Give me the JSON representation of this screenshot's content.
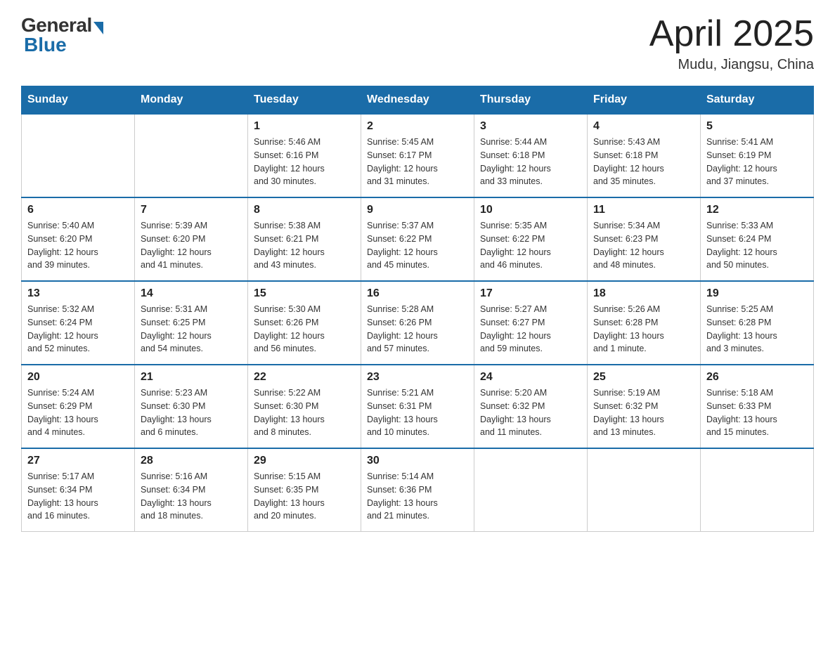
{
  "header": {
    "logo": {
      "general": "General",
      "blue": "Blue"
    },
    "title": "April 2025",
    "location": "Mudu, Jiangsu, China"
  },
  "calendar": {
    "days_of_week": [
      "Sunday",
      "Monday",
      "Tuesday",
      "Wednesday",
      "Thursday",
      "Friday",
      "Saturday"
    ],
    "weeks": [
      [
        {
          "day": "",
          "info": ""
        },
        {
          "day": "",
          "info": ""
        },
        {
          "day": "1",
          "info": "Sunrise: 5:46 AM\nSunset: 6:16 PM\nDaylight: 12 hours\nand 30 minutes."
        },
        {
          "day": "2",
          "info": "Sunrise: 5:45 AM\nSunset: 6:17 PM\nDaylight: 12 hours\nand 31 minutes."
        },
        {
          "day": "3",
          "info": "Sunrise: 5:44 AM\nSunset: 6:18 PM\nDaylight: 12 hours\nand 33 minutes."
        },
        {
          "day": "4",
          "info": "Sunrise: 5:43 AM\nSunset: 6:18 PM\nDaylight: 12 hours\nand 35 minutes."
        },
        {
          "day": "5",
          "info": "Sunrise: 5:41 AM\nSunset: 6:19 PM\nDaylight: 12 hours\nand 37 minutes."
        }
      ],
      [
        {
          "day": "6",
          "info": "Sunrise: 5:40 AM\nSunset: 6:20 PM\nDaylight: 12 hours\nand 39 minutes."
        },
        {
          "day": "7",
          "info": "Sunrise: 5:39 AM\nSunset: 6:20 PM\nDaylight: 12 hours\nand 41 minutes."
        },
        {
          "day": "8",
          "info": "Sunrise: 5:38 AM\nSunset: 6:21 PM\nDaylight: 12 hours\nand 43 minutes."
        },
        {
          "day": "9",
          "info": "Sunrise: 5:37 AM\nSunset: 6:22 PM\nDaylight: 12 hours\nand 45 minutes."
        },
        {
          "day": "10",
          "info": "Sunrise: 5:35 AM\nSunset: 6:22 PM\nDaylight: 12 hours\nand 46 minutes."
        },
        {
          "day": "11",
          "info": "Sunrise: 5:34 AM\nSunset: 6:23 PM\nDaylight: 12 hours\nand 48 minutes."
        },
        {
          "day": "12",
          "info": "Sunrise: 5:33 AM\nSunset: 6:24 PM\nDaylight: 12 hours\nand 50 minutes."
        }
      ],
      [
        {
          "day": "13",
          "info": "Sunrise: 5:32 AM\nSunset: 6:24 PM\nDaylight: 12 hours\nand 52 minutes."
        },
        {
          "day": "14",
          "info": "Sunrise: 5:31 AM\nSunset: 6:25 PM\nDaylight: 12 hours\nand 54 minutes."
        },
        {
          "day": "15",
          "info": "Sunrise: 5:30 AM\nSunset: 6:26 PM\nDaylight: 12 hours\nand 56 minutes."
        },
        {
          "day": "16",
          "info": "Sunrise: 5:28 AM\nSunset: 6:26 PM\nDaylight: 12 hours\nand 57 minutes."
        },
        {
          "day": "17",
          "info": "Sunrise: 5:27 AM\nSunset: 6:27 PM\nDaylight: 12 hours\nand 59 minutes."
        },
        {
          "day": "18",
          "info": "Sunrise: 5:26 AM\nSunset: 6:28 PM\nDaylight: 13 hours\nand 1 minute."
        },
        {
          "day": "19",
          "info": "Sunrise: 5:25 AM\nSunset: 6:28 PM\nDaylight: 13 hours\nand 3 minutes."
        }
      ],
      [
        {
          "day": "20",
          "info": "Sunrise: 5:24 AM\nSunset: 6:29 PM\nDaylight: 13 hours\nand 4 minutes."
        },
        {
          "day": "21",
          "info": "Sunrise: 5:23 AM\nSunset: 6:30 PM\nDaylight: 13 hours\nand 6 minutes."
        },
        {
          "day": "22",
          "info": "Sunrise: 5:22 AM\nSunset: 6:30 PM\nDaylight: 13 hours\nand 8 minutes."
        },
        {
          "day": "23",
          "info": "Sunrise: 5:21 AM\nSunset: 6:31 PM\nDaylight: 13 hours\nand 10 minutes."
        },
        {
          "day": "24",
          "info": "Sunrise: 5:20 AM\nSunset: 6:32 PM\nDaylight: 13 hours\nand 11 minutes."
        },
        {
          "day": "25",
          "info": "Sunrise: 5:19 AM\nSunset: 6:32 PM\nDaylight: 13 hours\nand 13 minutes."
        },
        {
          "day": "26",
          "info": "Sunrise: 5:18 AM\nSunset: 6:33 PM\nDaylight: 13 hours\nand 15 minutes."
        }
      ],
      [
        {
          "day": "27",
          "info": "Sunrise: 5:17 AM\nSunset: 6:34 PM\nDaylight: 13 hours\nand 16 minutes."
        },
        {
          "day": "28",
          "info": "Sunrise: 5:16 AM\nSunset: 6:34 PM\nDaylight: 13 hours\nand 18 minutes."
        },
        {
          "day": "29",
          "info": "Sunrise: 5:15 AM\nSunset: 6:35 PM\nDaylight: 13 hours\nand 20 minutes."
        },
        {
          "day": "30",
          "info": "Sunrise: 5:14 AM\nSunset: 6:36 PM\nDaylight: 13 hours\nand 21 minutes."
        },
        {
          "day": "",
          "info": ""
        },
        {
          "day": "",
          "info": ""
        },
        {
          "day": "",
          "info": ""
        }
      ]
    ]
  }
}
